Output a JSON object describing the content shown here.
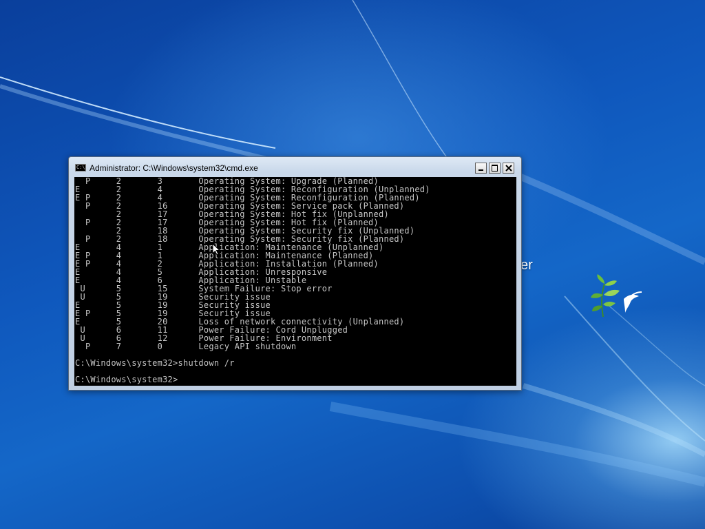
{
  "desktop": {
    "partial_text": "er"
  },
  "window": {
    "title": "Administrator: C:\\Windows\\system32\\cmd.exe",
    "icon": "cmd-console-icon",
    "controls": [
      "minimize",
      "maximize",
      "close"
    ]
  },
  "console": {
    "rows": [
      {
        "flags": "  P",
        "major": "2",
        "minor": "3",
        "reason": "Operating System: Upgrade (Planned)"
      },
      {
        "flags": "E",
        "major": "2",
        "minor": "4",
        "reason": "Operating System: Reconfiguration (Unplanned)"
      },
      {
        "flags": "E P",
        "major": "2",
        "minor": "4",
        "reason": "Operating System: Reconfiguration (Planned)"
      },
      {
        "flags": "  P",
        "major": "2",
        "minor": "16",
        "reason": "Operating System: Service pack (Planned)"
      },
      {
        "flags": "",
        "major": "2",
        "minor": "17",
        "reason": "Operating System: Hot fix (Unplanned)"
      },
      {
        "flags": "  P",
        "major": "2",
        "minor": "17",
        "reason": "Operating System: Hot fix (Planned)"
      },
      {
        "flags": "",
        "major": "2",
        "minor": "18",
        "reason": "Operating System: Security fix (Unplanned)"
      },
      {
        "flags": "  P",
        "major": "2",
        "minor": "18",
        "reason": "Operating System: Security fix (Planned)"
      },
      {
        "flags": "E",
        "major": "4",
        "minor": "1",
        "reason": "Application: Maintenance (Unplanned)"
      },
      {
        "flags": "E P",
        "major": "4",
        "minor": "1",
        "reason": "Application: Maintenance (Planned)"
      },
      {
        "flags": "E P",
        "major": "4",
        "minor": "2",
        "reason": "Application: Installation (Planned)"
      },
      {
        "flags": "E",
        "major": "4",
        "minor": "5",
        "reason": "Application: Unresponsive"
      },
      {
        "flags": "E",
        "major": "4",
        "minor": "6",
        "reason": "Application: Unstable"
      },
      {
        "flags": " U",
        "major": "5",
        "minor": "15",
        "reason": "System Failure: Stop error"
      },
      {
        "flags": " U",
        "major": "5",
        "minor": "19",
        "reason": "Security issue"
      },
      {
        "flags": "E",
        "major": "5",
        "minor": "19",
        "reason": "Security issue"
      },
      {
        "flags": "E P",
        "major": "5",
        "minor": "19",
        "reason": "Security issue"
      },
      {
        "flags": "E",
        "major": "5",
        "minor": "20",
        "reason": "Loss of network connectivity (Unplanned)"
      },
      {
        "flags": " U",
        "major": "6",
        "minor": "11",
        "reason": "Power Failure: Cord Unplugged"
      },
      {
        "flags": " U",
        "major": "6",
        "minor": "12",
        "reason": "Power Failure: Environment"
      },
      {
        "flags": "  P",
        "major": "7",
        "minor": "0",
        "reason": "Legacy API shutdown"
      }
    ],
    "command_prompt": "C:\\Windows\\system32>",
    "command": "shutdown /r",
    "final_prompt": "C:\\Windows\\system32>"
  }
}
